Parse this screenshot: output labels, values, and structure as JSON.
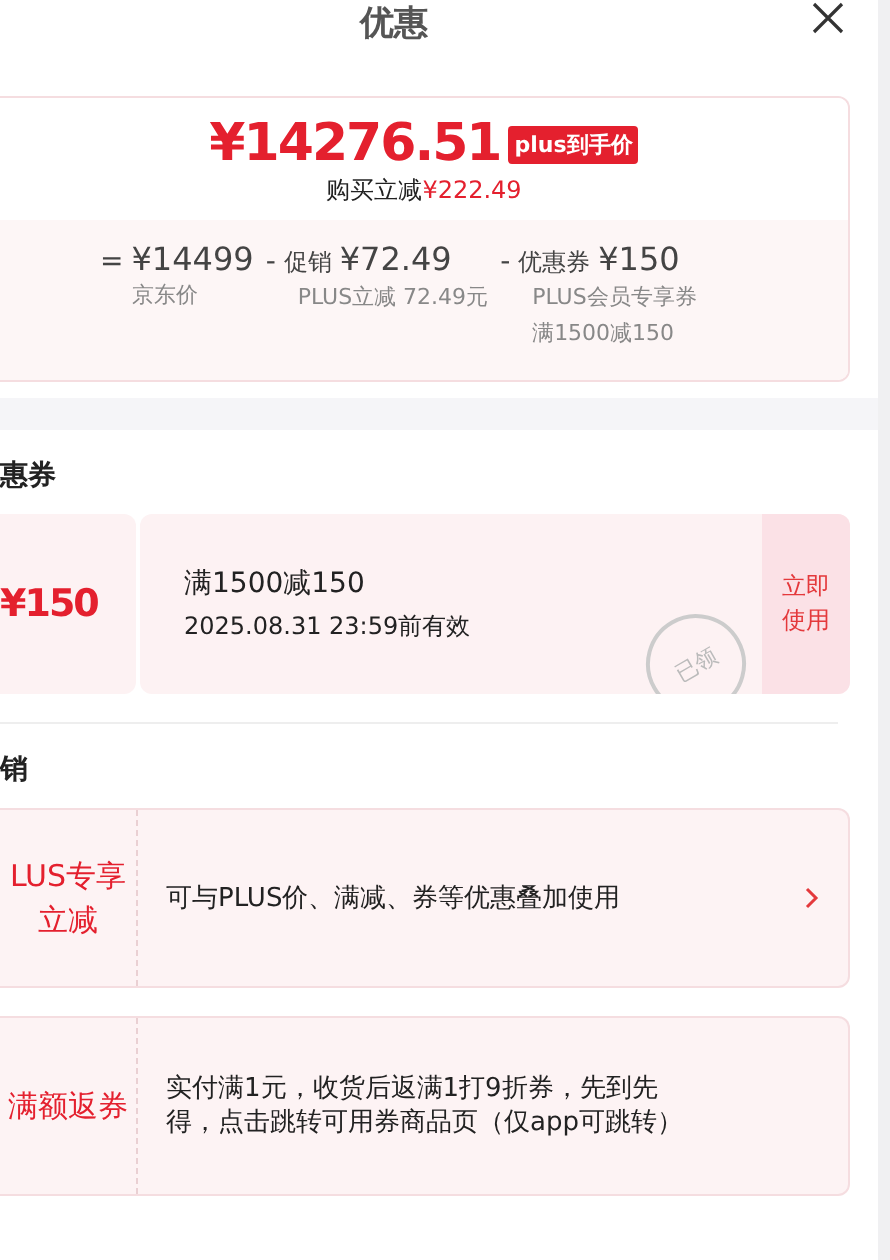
{
  "title": "优惠",
  "summary": {
    "price": "¥14276.51",
    "price_tag": "plus到手价",
    "saving_label": "购买立减",
    "saving": "¥222.49",
    "breakdown": [
      {
        "op": "=",
        "amount": "¥14499",
        "notes": [
          "京东价"
        ]
      },
      {
        "op": "-",
        "name": "促销",
        "amount": "¥72.49",
        "notes": [
          "PLUS立减 72.49元"
        ]
      },
      {
        "op": "-",
        "name": "优惠券",
        "amount": "¥150",
        "notes": [
          "PLUS会员专享券",
          "满1500减150"
        ]
      }
    ]
  },
  "coupon_section": {
    "heading": "惠券",
    "coupons": [
      {
        "value": "¥150",
        "condition": "满1500减150",
        "validity": "2025.08.31 23:59前有效",
        "stamp": "已领",
        "action": "立即使用"
      }
    ]
  },
  "promo_section": {
    "heading": "销",
    "promos": [
      {
        "tag": "LUS专享立减",
        "text": "可与PLUS价、满减、券等优惠叠加使用",
        "has_arrow": true
      },
      {
        "tag": "满额返券",
        "text": "实付满1元，收货后返满1打9折券，先到先得，点击跳转可用券商品页（仅app可跳转）",
        "has_arrow": false
      }
    ]
  }
}
